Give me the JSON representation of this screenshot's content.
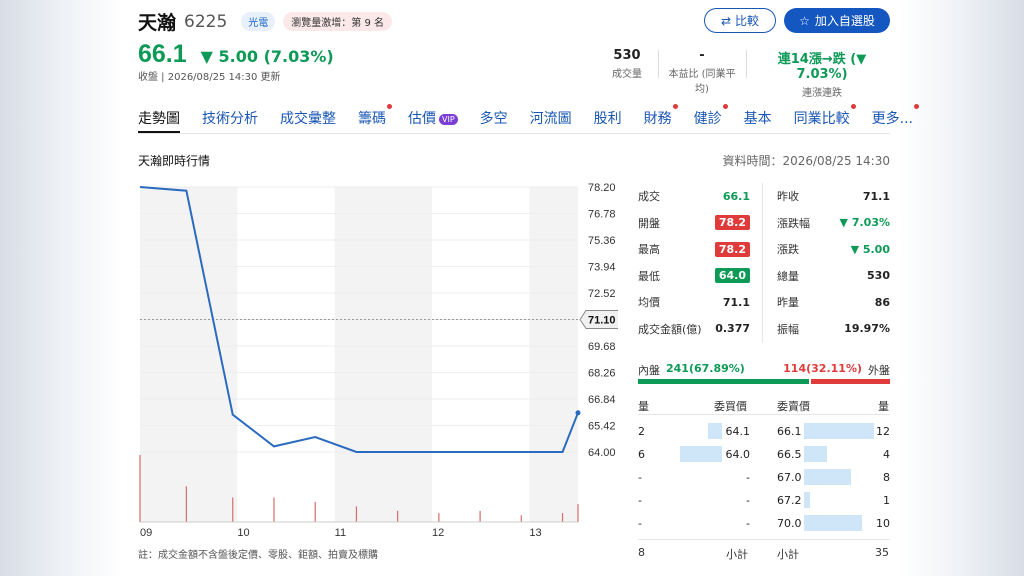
{
  "stock": {
    "name": "天瀚",
    "code": "6225",
    "sector_tag": "光電",
    "rank_tag": "瀏覽量激增：第 9 名",
    "price": "66.1",
    "change": "▼ 5.00 (7.03%)",
    "status": "收盤 | 2026/08/25 14:30 更新"
  },
  "buttons": {
    "compare": "比較",
    "add_watchlist": "加入自選股"
  },
  "stats": [
    {
      "value": "530",
      "label": "成交量"
    },
    {
      "value": "-",
      "label": "本益比 (同業平均)"
    },
    {
      "value": "連14漲→跌 (▼ 7.03%)",
      "label": "連漲連跌"
    }
  ],
  "tabs": [
    {
      "label": "走勢圖",
      "dot": false,
      "vip": false
    },
    {
      "label": "技術分析",
      "dot": false,
      "vip": false
    },
    {
      "label": "成交彙整",
      "dot": false,
      "vip": false
    },
    {
      "label": "籌碼",
      "dot": true,
      "vip": false
    },
    {
      "label": "估價",
      "dot": false,
      "vip": true
    },
    {
      "label": "多空",
      "dot": false,
      "vip": false
    },
    {
      "label": "河流圖",
      "dot": false,
      "vip": false
    },
    {
      "label": "股利",
      "dot": false,
      "vip": false
    },
    {
      "label": "財務",
      "dot": true,
      "vip": false
    },
    {
      "label": "健診",
      "dot": true,
      "vip": false
    },
    {
      "label": "基本",
      "dot": false,
      "vip": false
    },
    {
      "label": "同業比較",
      "dot": true,
      "vip": false
    },
    {
      "label": "更多...",
      "dot": true,
      "vip": false
    }
  ],
  "vip_label": "VIP",
  "section_title": "天瀚即時行情",
  "data_time": "資料時間：2026/08/25 14:30",
  "chart_note": "註：成交金額不含盤後定價、零股、鉅額、拍賣及標購",
  "chart_data": {
    "type": "line",
    "x_ticks": [
      "09",
      "10",
      "11",
      "12",
      "13"
    ],
    "y_ticks": [
      "78.20",
      "76.78",
      "75.36",
      "73.94",
      "72.52",
      "71.10",
      "69.68",
      "68.26",
      "66.84",
      "65.42",
      "64.00"
    ],
    "ylim": [
      64.0,
      78.2
    ],
    "reference_price": "71.10",
    "x_minutes": [
      0,
      45,
      90,
      130,
      170,
      210,
      250,
      290,
      330,
      370,
      410,
      425
    ],
    "x_range_minutes": [
      0,
      270
    ],
    "y": [
      78.2,
      78.0,
      66.0,
      64.3,
      64.8,
      64.0,
      64.0,
      64.0,
      64.0,
      64.0,
      64.0,
      66.1
    ],
    "volume_minutes": [
      0,
      45,
      90,
      130,
      170,
      210,
      250,
      290,
      330,
      370,
      410,
      425
    ],
    "volume": [
      60,
      32,
      22,
      22,
      18,
      14,
      10,
      8,
      10,
      6,
      8,
      16
    ]
  },
  "quote": {
    "left": [
      {
        "label": "成交",
        "value": "66.1",
        "style": "green"
      },
      {
        "label": "開盤",
        "value": "78.2",
        "style": "red-badge"
      },
      {
        "label": "最高",
        "value": "78.2",
        "style": "red-badge"
      },
      {
        "label": "最低",
        "value": "64.0",
        "style": "green-badge"
      },
      {
        "label": "均價",
        "value": "71.1",
        "style": "plain"
      },
      {
        "label": "成交金額(億)",
        "value": "0.377",
        "style": "plain"
      }
    ],
    "right": [
      {
        "label": "昨收",
        "value": "71.1",
        "style": "plain"
      },
      {
        "label": "漲跌幅",
        "value": "▼ 7.03%",
        "style": "green"
      },
      {
        "label": "漲跌",
        "value": "▼ 5.00",
        "style": "green"
      },
      {
        "label": "總量",
        "value": "530",
        "style": "plain"
      },
      {
        "label": "昨量",
        "value": "86",
        "style": "plain"
      },
      {
        "label": "振幅",
        "value": "19.97%",
        "style": "plain"
      }
    ]
  },
  "inner_outer": {
    "inner_label": "內盤",
    "inner_value": "241(67.89%)",
    "outer_value": "114(32.11%)",
    "outer_label": "外盤",
    "inner_ratio": 0.6789,
    "inner_color": "#0d9a56",
    "outer_color": "#e03b3b"
  },
  "order_book": {
    "headers": {
      "bid_qty": "量",
      "bid_price": "委買價",
      "ask_price": "委賣價",
      "ask_qty": "量"
    },
    "rows": [
      {
        "bid_qty": "2",
        "bid_price": "64.1",
        "bid_ratio": 0.33,
        "ask_price": "66.1",
        "ask_qty": "12",
        "ask_ratio": 1.0
      },
      {
        "bid_qty": "6",
        "bid_price": "64.0",
        "bid_ratio": 1.0,
        "ask_price": "66.5",
        "ask_qty": "4",
        "ask_ratio": 0.33
      },
      {
        "bid_qty": "-",
        "bid_price": "-",
        "bid_ratio": 0,
        "ask_price": "67.0",
        "ask_qty": "8",
        "ask_ratio": 0.67
      },
      {
        "bid_qty": "-",
        "bid_price": "-",
        "bid_ratio": 0,
        "ask_price": "67.2",
        "ask_qty": "1",
        "ask_ratio": 0.08
      },
      {
        "bid_qty": "-",
        "bid_price": "-",
        "bid_ratio": 0,
        "ask_price": "70.0",
        "ask_qty": "10",
        "ask_ratio": 0.83
      }
    ],
    "bid_total": "8",
    "bid_subtotal_label": "小計",
    "ask_subtotal_label": "小計",
    "ask_total": "35"
  }
}
